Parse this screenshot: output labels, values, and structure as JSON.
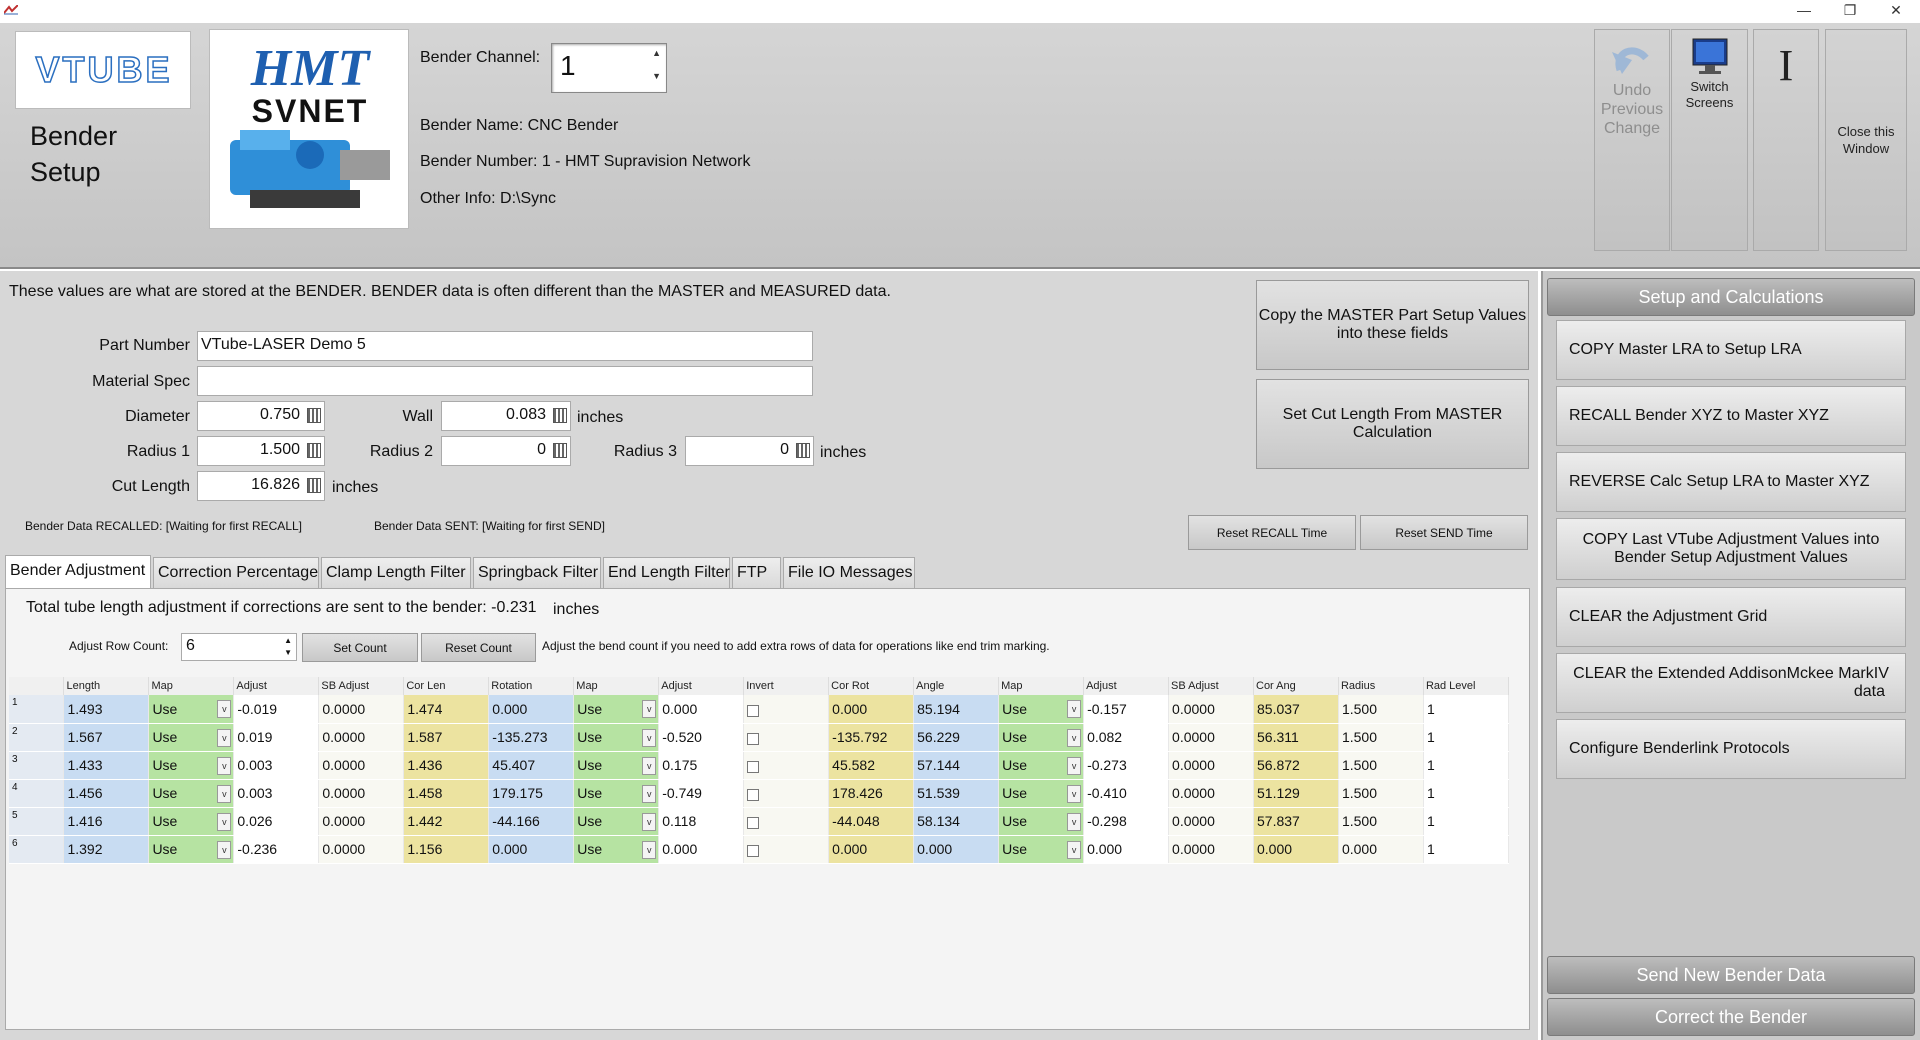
{
  "window": {
    "minimize_glyph": "—",
    "restore_glyph": "❐",
    "close_glyph": "✕"
  },
  "header": {
    "logo_vtube_text": "VTUBE",
    "title": "Bender",
    "title_line2": "Setup",
    "logo_hmt_line1": "HMT",
    "logo_hmt_line2": "SVNET",
    "channel_label": "Bender Channel:",
    "channel_value": "1",
    "bender_name": "Bender Name:  CNC Bender",
    "bender_number": "Bender Number:  1 - HMT Supravision Network",
    "other_info": "Other Info:  D:\\Sync",
    "undo_label_1": "Undo",
    "undo_label_2": "Previous",
    "undo_label_3": "Change",
    "switch_label_1": "Switch",
    "switch_label_2": "Screens",
    "cursor_glyph": "I",
    "close_label_1": "Close this",
    "close_label_2": "Window"
  },
  "info_text": "These values are what are stored at the BENDER.  BENDER data is often different than the MASTER and MEASURED data.",
  "fields": {
    "part_number_label": "Part Number",
    "part_number_value": "VTube-LASER Demo 5",
    "material_spec_label": "Material Spec",
    "material_spec_value": "",
    "diameter_label": "Diameter",
    "diameter_value": "0.750",
    "wall_label": "Wall",
    "wall_value": "0.083",
    "inches_1": "inches",
    "radius1_label": "Radius 1",
    "radius1_value": "1.500",
    "radius2_label": "Radius 2",
    "radius2_value": "0",
    "radius3_label": "Radius 3",
    "radius3_value": "0",
    "inches_2": "inches",
    "cut_length_label": "Cut Length",
    "cut_length_value": "16.826",
    "inches_3": "inches",
    "recalled_label": "Bender Data RECALLED:  [Waiting for first RECALL]",
    "sent_label": "Bender Data SENT:  [Waiting for first SEND]"
  },
  "buttons": {
    "copy_master_line1": "Copy the MASTER Part Setup Values",
    "copy_master_line2": "into these fields",
    "set_cut_line1": "Set Cut Length From MASTER",
    "set_cut_line2": "Calculation",
    "reset_recall": "Reset RECALL Time",
    "reset_send": "Reset SEND Time",
    "set_count": "Set Count",
    "reset_count": "Reset Count"
  },
  "tabs": [
    "Bender Adjustment",
    "Correction Percentage",
    "Clamp Length Filter",
    "Springback Filter",
    "End Length Filter",
    "FTP",
    "File IO Messages"
  ],
  "adjustment": {
    "total_label": "Total tube length adjustment if corrections are sent to the bender:  -0.231",
    "total_units": "inches",
    "row_count_label": "Adjust Row Count:",
    "row_count_value": "6",
    "hint": "Adjust the bend count if you need to add extra rows of data for operations like end trim marking."
  },
  "grid": {
    "headers": [
      "Length",
      "Map",
      "Adjust",
      "SB Adjust",
      "Cor Len",
      "Rotation",
      "Map",
      "Adjust",
      "Invert",
      "Cor Rot",
      "Angle",
      "Map",
      "Adjust",
      "SB Adjust",
      "Cor Ang",
      "Radius",
      "Rad Level"
    ],
    "rows": [
      {
        "n": "1",
        "length": "1.493",
        "map1": "Use",
        "adj1": "-0.019",
        "sb1": "0.0000",
        "corlen": "1.474",
        "rot": "0.000",
        "map2": "Use",
        "adj2": "0.000",
        "corrot": "0.000",
        "angle": "85.194",
        "map3": "Use",
        "adj3": "-0.157",
        "sb3": "0.0000",
        "corang": "85.037",
        "radius": "1.500",
        "radlevel": "1"
      },
      {
        "n": "2",
        "length": "1.567",
        "map1": "Use",
        "adj1": "0.019",
        "sb1": "0.0000",
        "corlen": "1.587",
        "rot": "-135.273",
        "map2": "Use",
        "adj2": "-0.520",
        "corrot": "-135.792",
        "angle": "56.229",
        "map3": "Use",
        "adj3": "0.082",
        "sb3": "0.0000",
        "corang": "56.311",
        "radius": "1.500",
        "radlevel": "1"
      },
      {
        "n": "3",
        "length": "1.433",
        "map1": "Use",
        "adj1": "0.003",
        "sb1": "0.0000",
        "corlen": "1.436",
        "rot": "45.407",
        "map2": "Use",
        "adj2": "0.175",
        "corrot": "45.582",
        "angle": "57.144",
        "map3": "Use",
        "adj3": "-0.273",
        "sb3": "0.0000",
        "corang": "56.872",
        "radius": "1.500",
        "radlevel": "1"
      },
      {
        "n": "4",
        "length": "1.456",
        "map1": "Use",
        "adj1": "0.003",
        "sb1": "0.0000",
        "corlen": "1.458",
        "rot": "179.175",
        "map2": "Use",
        "adj2": "-0.749",
        "corrot": "178.426",
        "angle": "51.539",
        "map3": "Use",
        "adj3": "-0.410",
        "sb3": "0.0000",
        "corang": "51.129",
        "radius": "1.500",
        "radlevel": "1"
      },
      {
        "n": "5",
        "length": "1.416",
        "map1": "Use",
        "adj1": "0.026",
        "sb1": "0.0000",
        "corlen": "1.442",
        "rot": "-44.166",
        "map2": "Use",
        "adj2": "0.118",
        "corrot": "-44.048",
        "angle": "58.134",
        "map3": "Use",
        "adj3": "-0.298",
        "sb3": "0.0000",
        "corang": "57.837",
        "radius": "1.500",
        "radlevel": "1"
      },
      {
        "n": "6",
        "length": "1.392",
        "map1": "Use",
        "adj1": "-0.236",
        "sb1": "0.0000",
        "corlen": "1.156",
        "rot": "0.000",
        "map2": "Use",
        "adj2": "0.000",
        "corrot": "0.000",
        "angle": "0.000",
        "map3": "Use",
        "adj3": "0.000",
        "sb3": "0.0000",
        "corang": "0.000",
        "radius": "0.000",
        "radlevel": "1"
      }
    ]
  },
  "right": {
    "section_title": "Setup and Calculations",
    "items": [
      {
        "label": "COPY Master LRA to Setup LRA"
      },
      {
        "label": "RECALL Bender XYZ to Master XYZ"
      },
      {
        "label": "REVERSE Calc Setup LRA to Master XYZ"
      },
      {
        "label": "COPY Last VTube Adjustment Values into",
        "label2": "Bender Setup Adjustment Values"
      },
      {
        "label": "CLEAR the Adjustment Grid"
      },
      {
        "label": "CLEAR the Extended AddisonMckee MarkIV",
        "label2": "data"
      },
      {
        "label": "Configure Benderlink Protocols"
      }
    ],
    "send": "Send New Bender Data",
    "correct": "Correct the Bender"
  },
  "colors": {
    "accent_green": "#b6e3a2",
    "accent_blue": "#c8dcf2",
    "accent_yellow": "#ece3a0",
    "logo_blue": "#2b6fc0"
  }
}
